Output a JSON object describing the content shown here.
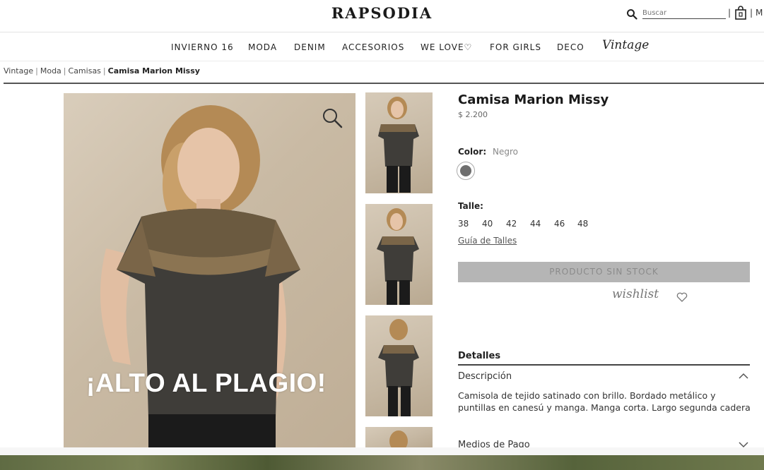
{
  "header": {
    "logo": "RAPSODIA",
    "search_placeholder": "Buscar",
    "separator": "|",
    "cut_text": "M"
  },
  "nav": {
    "items": [
      "INVIERNO 16",
      "MODA",
      "DENIM",
      "ACCESORIOS",
      "WE LOVE♡",
      "FOR GIRLS",
      "DECO"
    ],
    "vintage": "Vintage"
  },
  "breadcrumb": {
    "items": [
      "Vintage",
      "Moda",
      "Camisas"
    ],
    "current": "Camisa Marion Missy",
    "separator": "|"
  },
  "gallery": {
    "watermark": "¡ALTO AL PLAGIO!"
  },
  "product": {
    "title": "Camisa Marion Missy",
    "price": "$ 2.200",
    "color_label": "Color:",
    "color_value": "Negro",
    "swatch_color": "#6e6e6e",
    "size_label": "Talle:",
    "sizes": [
      "38",
      "40",
      "42",
      "44",
      "46",
      "48"
    ],
    "size_guide": "Guía de Talles",
    "stock_button": "PRODUCTO SIN STOCK",
    "wishlist": "wishlist"
  },
  "details": {
    "title": "Detalles",
    "description_title": "Descripción",
    "description_text": "Camisola de tejido satinado con brillo. Bordado metálico y puntillas en canesú y manga. Manga corta. Largo segunda cadera",
    "payment_title": "Medios de Pago"
  }
}
